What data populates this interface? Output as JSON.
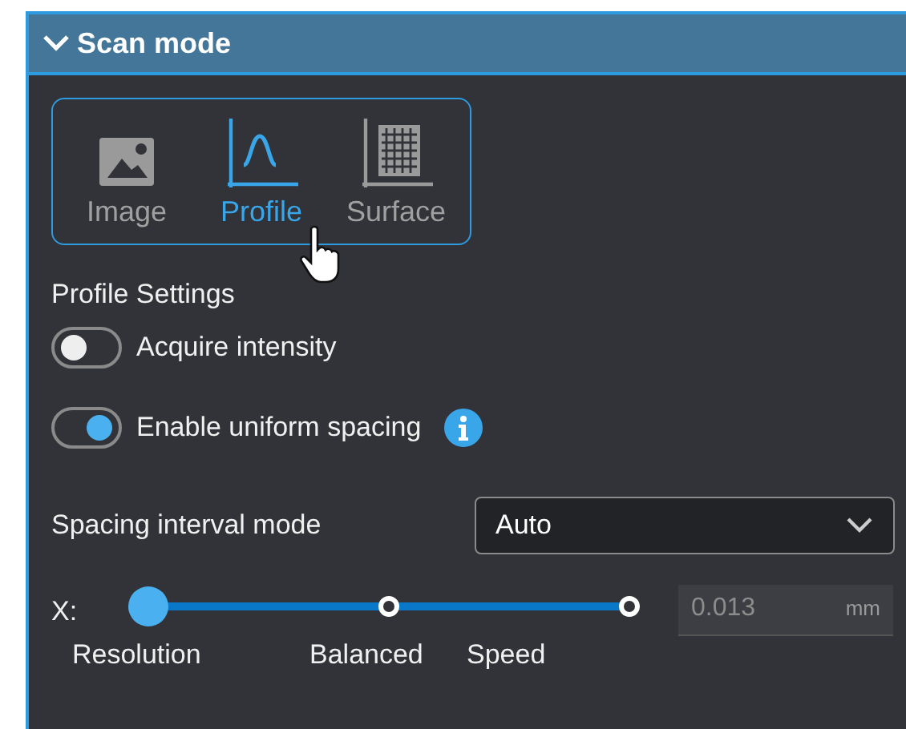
{
  "panel": {
    "title": "Scan mode",
    "expanded": true
  },
  "modes": [
    {
      "label": "Image",
      "kind": "image",
      "selected": false
    },
    {
      "label": "Profile",
      "kind": "profile",
      "selected": true
    },
    {
      "label": "Surface",
      "kind": "surface",
      "selected": false
    }
  ],
  "section_title": "Profile Settings",
  "toggles": [
    {
      "label": "Acquire intensity",
      "on": false,
      "info": false
    },
    {
      "label": "Enable uniform spacing",
      "on": true,
      "info": true
    }
  ],
  "spacing": {
    "label": "Spacing interval mode",
    "value": "Auto"
  },
  "slider": {
    "axis": "X:",
    "level": 0,
    "stops": [
      "Resolution",
      "Balanced",
      "Speed"
    ],
    "value": "0.013",
    "unit": "mm"
  }
}
